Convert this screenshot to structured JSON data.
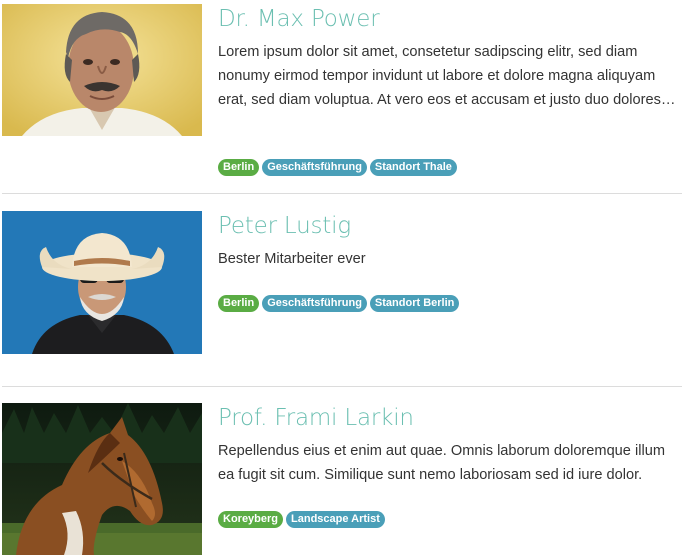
{
  "people": [
    {
      "name": "Dr. Max Power",
      "description": "Lorem ipsum dolor sit amet, consetetur sadipscing elitr, sed diam nonumy eirmod tempor invidunt ut labore et dolore magna aliquyam erat, sed diam voluptua. At vero eos et accusam et justo duo dolores…",
      "photo": "portrait of grey-haired man with mustache",
      "tags": [
        {
          "label": "Berlin",
          "color": "#5aac44"
        },
        {
          "label": "Geschäftsführung",
          "color": "#4a9fb8"
        },
        {
          "label": "Standort Thale",
          "color": "#4a9fb8"
        }
      ]
    },
    {
      "name": "Peter Lustig",
      "description": "Bester Mitarbeiter ever",
      "photo": "portrait of old man with cowboy hat and sunglasses",
      "tags": [
        {
          "label": "Berlin",
          "color": "#5aac44"
        },
        {
          "label": "Geschäftsführung",
          "color": "#4a9fb8"
        },
        {
          "label": "Standort Berlin",
          "color": "#4a9fb8"
        }
      ]
    },
    {
      "name": "Prof. Frami Larkin",
      "description": "Repellendus eius et enim aut quae. Omnis laborum doloremque illum ea fugit sit cum. Similique sunt nemo laboriosam sed id iure dolor.",
      "photo": "brown horse in a forest",
      "tags": [
        {
          "label": "Koreyberg",
          "color": "#5aac44"
        },
        {
          "label": "Landscape Artist",
          "color": "#4a9fb8"
        }
      ]
    }
  ],
  "colors": {
    "name": "#6bbfb1",
    "tag_location": "#5aac44",
    "tag_role": "#4a9fb8",
    "divider": "#dcdcdc"
  }
}
